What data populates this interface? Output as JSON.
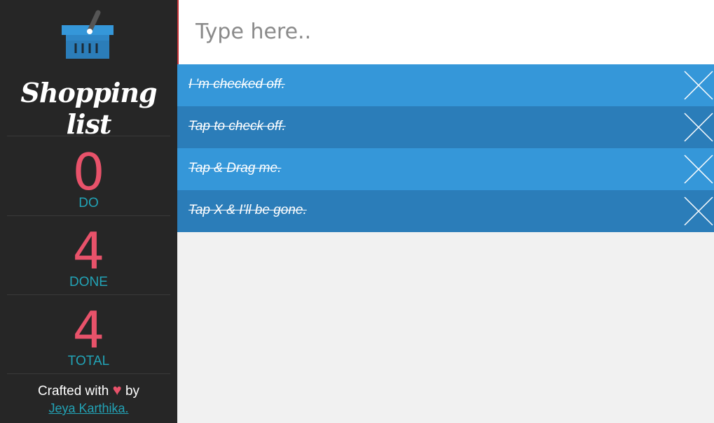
{
  "sidebar": {
    "title": "Shopping list",
    "logo_icon": "basket-icon",
    "stats": [
      {
        "value": "0",
        "label": "DO"
      },
      {
        "value": "4",
        "label": "DONE"
      },
      {
        "value": "4",
        "label": "TOTAL"
      }
    ],
    "footer": {
      "crafted_prefix": "Crafted with",
      "heart": "♥",
      "by": "by",
      "author": "Jeya Karthika."
    }
  },
  "input": {
    "placeholder": "Type here..",
    "value": ""
  },
  "items": [
    {
      "text": "I 'm checked off.",
      "checked": true
    },
    {
      "text": "Tap to check off.",
      "checked": true
    },
    {
      "text": "Tap & Drag me.",
      "checked": true
    },
    {
      "text": "Tap X & I'll be gone.",
      "checked": true
    }
  ],
  "colors": {
    "sidebar_bg": "#262626",
    "accent_red": "#e8526a",
    "accent_teal": "#22a3b6",
    "item_light": "#3597d9",
    "item_dark": "#2b7db9",
    "content_bg": "#f1f1f1"
  }
}
